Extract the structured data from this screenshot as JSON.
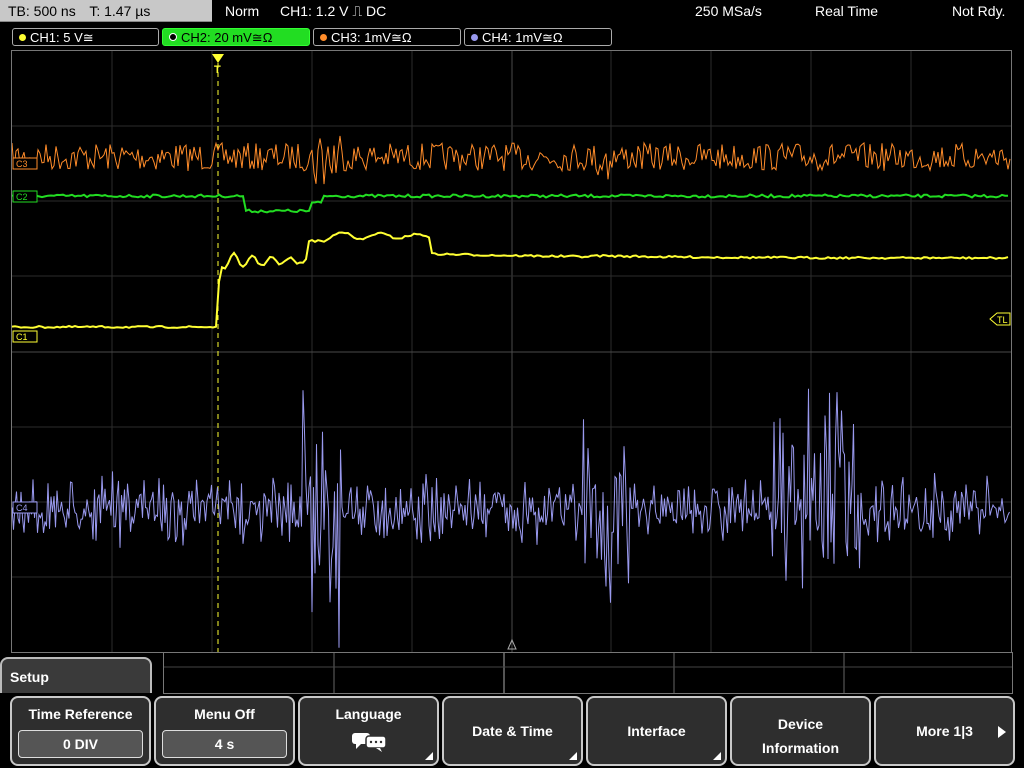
{
  "header": {
    "timebase": "TB: 500 ns",
    "trigger_time": "T: 1.47 µs",
    "mode": "Norm",
    "trigger_setting": "CH1: 1.2 V ⎍ DC",
    "sample_rate": "250 MSa/s",
    "acq_mode": "Real Time",
    "status": "Not Rdy."
  },
  "channels": [
    {
      "label": "CH1: 5 V≅",
      "color": "#ffff33"
    },
    {
      "label": "CH2: 20 mV≅Ω",
      "color": "#22dd22"
    },
    {
      "label": "CH3: 1mV≅Ω",
      "color": "#ff8c2a"
    },
    {
      "label": "CH4: 1mV≅Ω",
      "color": "#9999ee"
    }
  ],
  "markers": {
    "c1": "C1",
    "c2": "C2",
    "c3": "C3",
    "c4": "C4",
    "tl": "TL",
    "trigger": "T"
  },
  "softkeys": {
    "tab": "Setup",
    "time_reference_label": "Time Reference",
    "time_reference_value": "0 DIV",
    "menu_off_label": "Menu Off",
    "menu_off_value": "4 s",
    "language_label": "Language",
    "datetime_label": "Date & Time",
    "interface_label": "Interface",
    "device_info_line1": "Device",
    "device_info_line2": "Information",
    "more_label": "More 1|3"
  },
  "icons": {
    "language": "chat-bubbles-icon",
    "more": "arrow-right-icon"
  }
}
